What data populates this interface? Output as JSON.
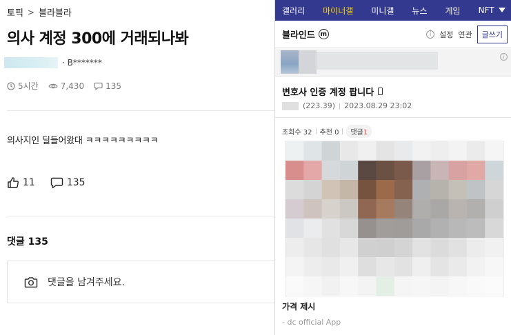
{
  "left": {
    "breadcrumb": {
      "section": "토픽",
      "separator": ">",
      "board": "블라블라"
    },
    "title": "의사 계정 300에 거래되나봐",
    "author": {
      "masked_name": "· B*******"
    },
    "meta": {
      "time": "5시간",
      "views": "7,430",
      "comments": "135"
    },
    "body": "의사지인 딜들어왔대 ㅋㅋㅋㅋㅋㅋㅋㅋㅋ",
    "reactions": {
      "likes": "11",
      "comments": "135"
    },
    "comments_heading": "댓글 135",
    "comment_placeholder": "댓글을 남겨주세요."
  },
  "right": {
    "nav": [
      "갤러리",
      "마이너갤",
      "미니갤",
      "뉴스",
      "게임"
    ],
    "nav_active_index": 1,
    "nav_nft": "NFT",
    "gallery_name": "블라인드",
    "gallery_badge": "m",
    "tools": {
      "settings": "설정",
      "related": "연관",
      "write": "글쓰기"
    },
    "post": {
      "title": "변호사 인증 계정 팝니다",
      "ip": "(223.39)",
      "datetime": "2023.08.29 23:02",
      "views_label": "조회수 32",
      "recommend_label": "추천 0",
      "comment_label": "댓글",
      "comment_count": "1",
      "body_text": "가격 제시",
      "footer": "- dc official App"
    }
  },
  "colors": {
    "dc_nav": "#33398f",
    "dc_nav_active": "#ffd800",
    "comment_count": "#e23e3e"
  }
}
